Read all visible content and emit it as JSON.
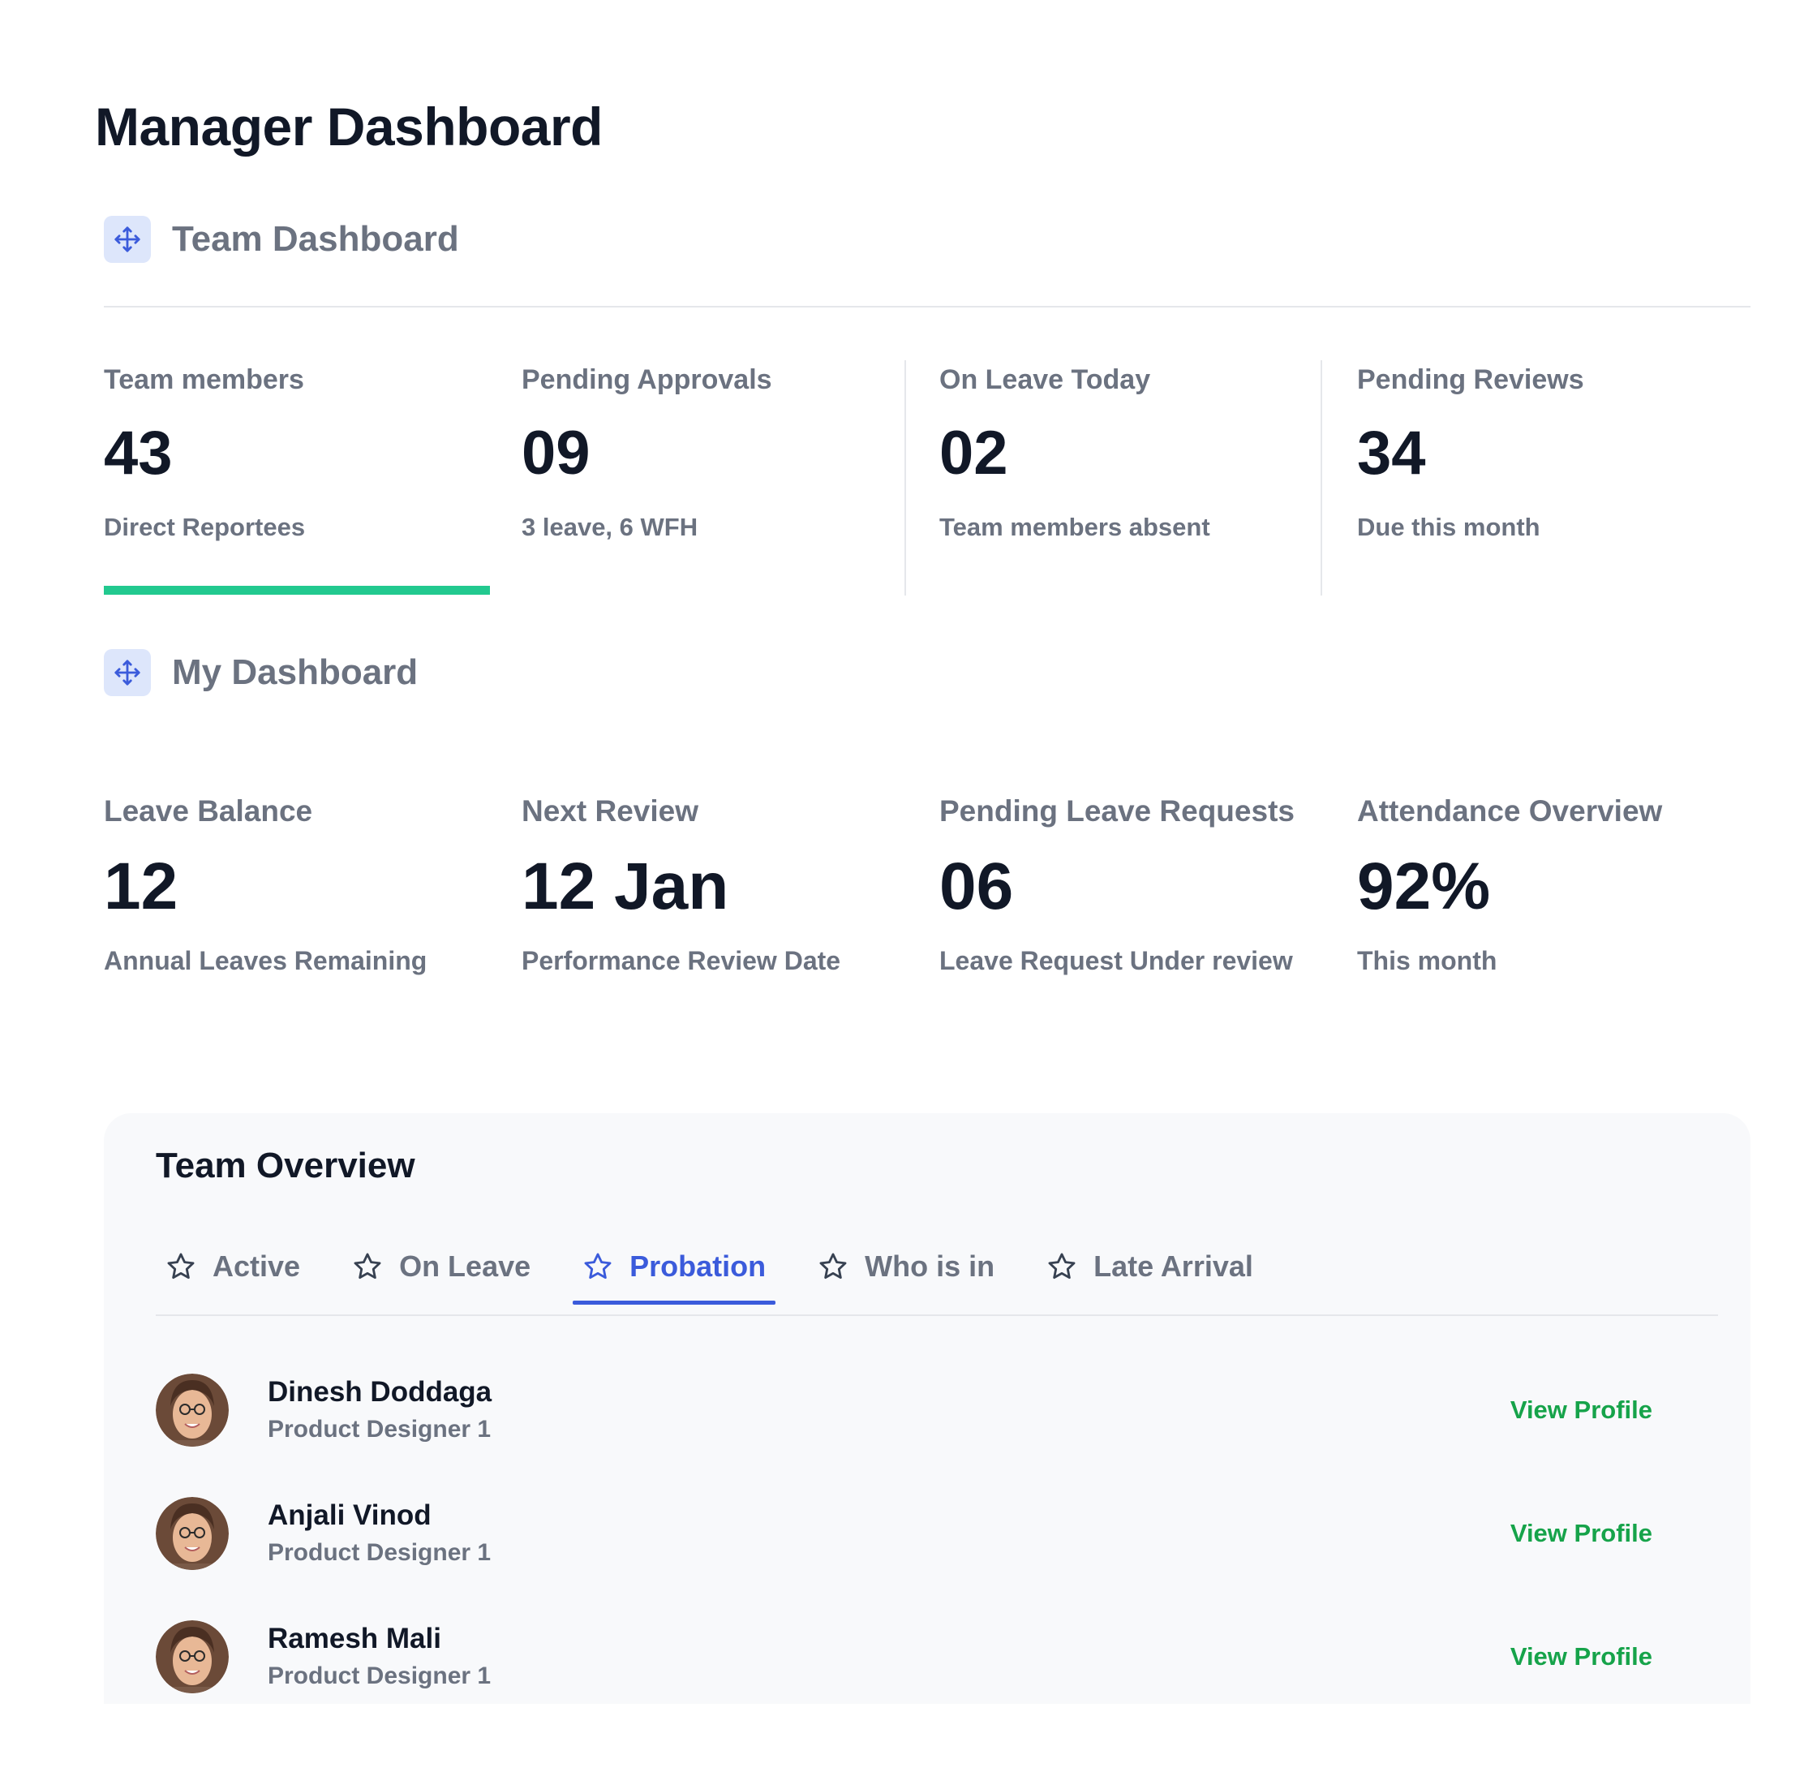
{
  "page": {
    "title": "Manager Dashboard"
  },
  "team_dashboard": {
    "title": "Team Dashboard",
    "icon": "move-icon",
    "stats": [
      {
        "label": "Team members",
        "value": "43",
        "sub": "Direct Reportees",
        "selected": true
      },
      {
        "label": "Pending Approvals",
        "value": "09",
        "sub": "3 leave, 6 WFH"
      },
      {
        "label": "On Leave Today",
        "value": "02",
        "sub": "Team members absent"
      },
      {
        "label": "Pending Reviews",
        "value": "34",
        "sub": "Due this month"
      }
    ]
  },
  "my_dashboard": {
    "title": "My Dashboard",
    "icon": "move-icon",
    "stats": [
      {
        "label": "Leave Balance",
        "value": "12",
        "sub": "Annual Leaves Remaining"
      },
      {
        "label": "Next Review",
        "value": "12 Jan",
        "sub": "Performance Review Date"
      },
      {
        "label": "Pending Leave Requests",
        "value": "06",
        "sub": "Leave Request Under review"
      },
      {
        "label": "Attendance Overview",
        "value": "92%",
        "sub": "This month"
      }
    ]
  },
  "team_overview": {
    "title": "Team Overview",
    "tabs": [
      {
        "label": "Active",
        "icon": "star-icon"
      },
      {
        "label": "On Leave",
        "icon": "star-icon"
      },
      {
        "label": "Probation",
        "icon": "star-icon",
        "selected": true
      },
      {
        "label": "Who is in",
        "icon": "star-icon"
      },
      {
        "label": "Late Arrival",
        "icon": "star-icon"
      }
    ],
    "members": [
      {
        "name": "Dinesh Doddaga",
        "role": "Product Designer 1",
        "action": "View Profile"
      },
      {
        "name": "Anjali Vinod",
        "role": "Product Designer 1",
        "action": "View Profile"
      },
      {
        "name": "Ramesh Mali",
        "role": "Product Designer 1",
        "action": "View Profile"
      }
    ]
  },
  "colors": {
    "accent_green": "#22c98f",
    "link_green": "#16a34a",
    "tab_blue": "#3b5bdb",
    "icon_blue": "#3b5bdb",
    "icon_bg": "#dde6fb"
  }
}
